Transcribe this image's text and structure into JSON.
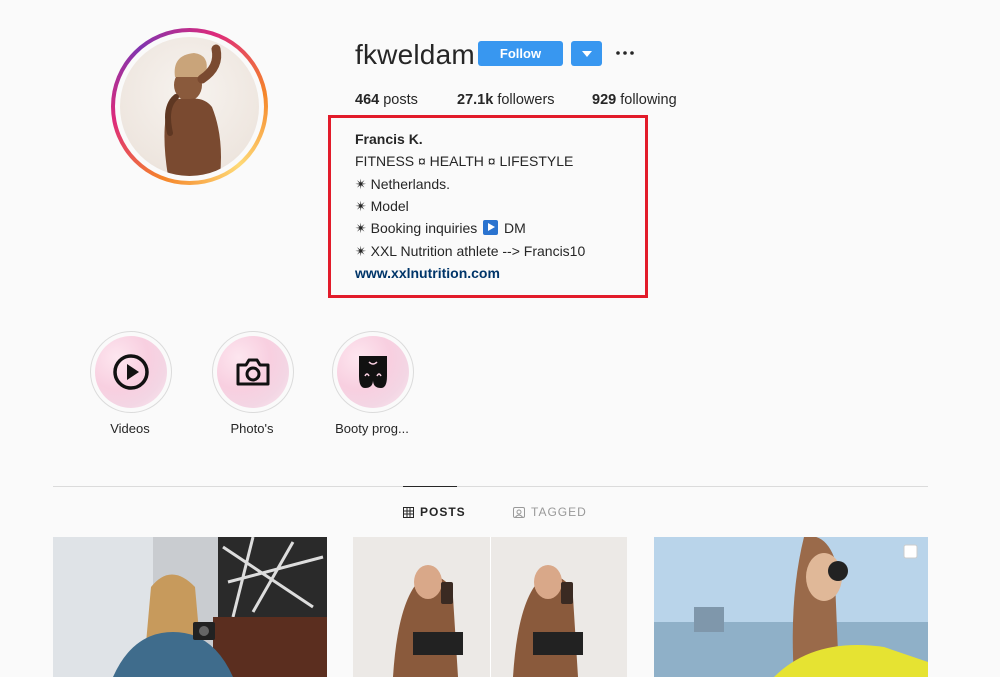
{
  "profile": {
    "username": "fkweldam",
    "follow_label": "Follow"
  },
  "stats": {
    "posts_count": "464",
    "posts_label": " posts",
    "followers_count": "27.1k",
    "followers_label": " followers",
    "following_count": "929",
    "following_label": " following"
  },
  "bio": {
    "name": "Francis K.",
    "line1": "FITNESS ¤ HEALTH ¤ LIFESTYLE",
    "line2": "✴ Netherlands.",
    "line3": "✴ Model",
    "line4_prefix": "✴ Booking inquiries",
    "line4_suffix": "DM",
    "line5": "✴ XXL Nutrition athlete --> Francis10",
    "link": "www.xxlnutrition.com"
  },
  "highlights": [
    {
      "label": "Videos",
      "icon": "play-circle-icon"
    },
    {
      "label": "Photo's",
      "icon": "camera-icon"
    },
    {
      "label": "Booty prog...",
      "icon": "booty-icon"
    }
  ],
  "tabs": {
    "posts": "POSTS",
    "tagged": "TAGGED"
  },
  "colors": {
    "accent_blue": "#3897f0",
    "highlight_box": "#e21b2a",
    "link": "#003569"
  }
}
